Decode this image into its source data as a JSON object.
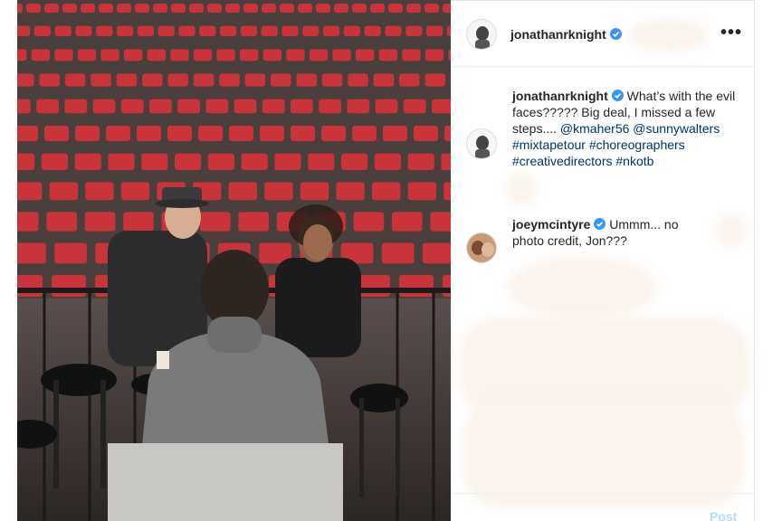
{
  "header": {
    "username": "jonathanrknight",
    "more_icon": "•••"
  },
  "caption": {
    "username": "jonathanrknight",
    "text": "What’s with the evil faces????? Big deal, I missed a few steps....",
    "mentions": [
      "@kmaher56",
      "@sunnywalters"
    ],
    "hashtags": [
      "#mixtapetour",
      "#choreographers",
      "#creativedirectors",
      "#nkotb"
    ]
  },
  "comment": {
    "username": "joeymcintyre",
    "text": "Ummm... no photo credit, Jon???"
  },
  "composer": {
    "post_label": "Post"
  },
  "colors": {
    "verified": "#3897f0",
    "link": "#003569",
    "post_disabled": "#b3dbff",
    "seat_red": "#c8343a"
  }
}
